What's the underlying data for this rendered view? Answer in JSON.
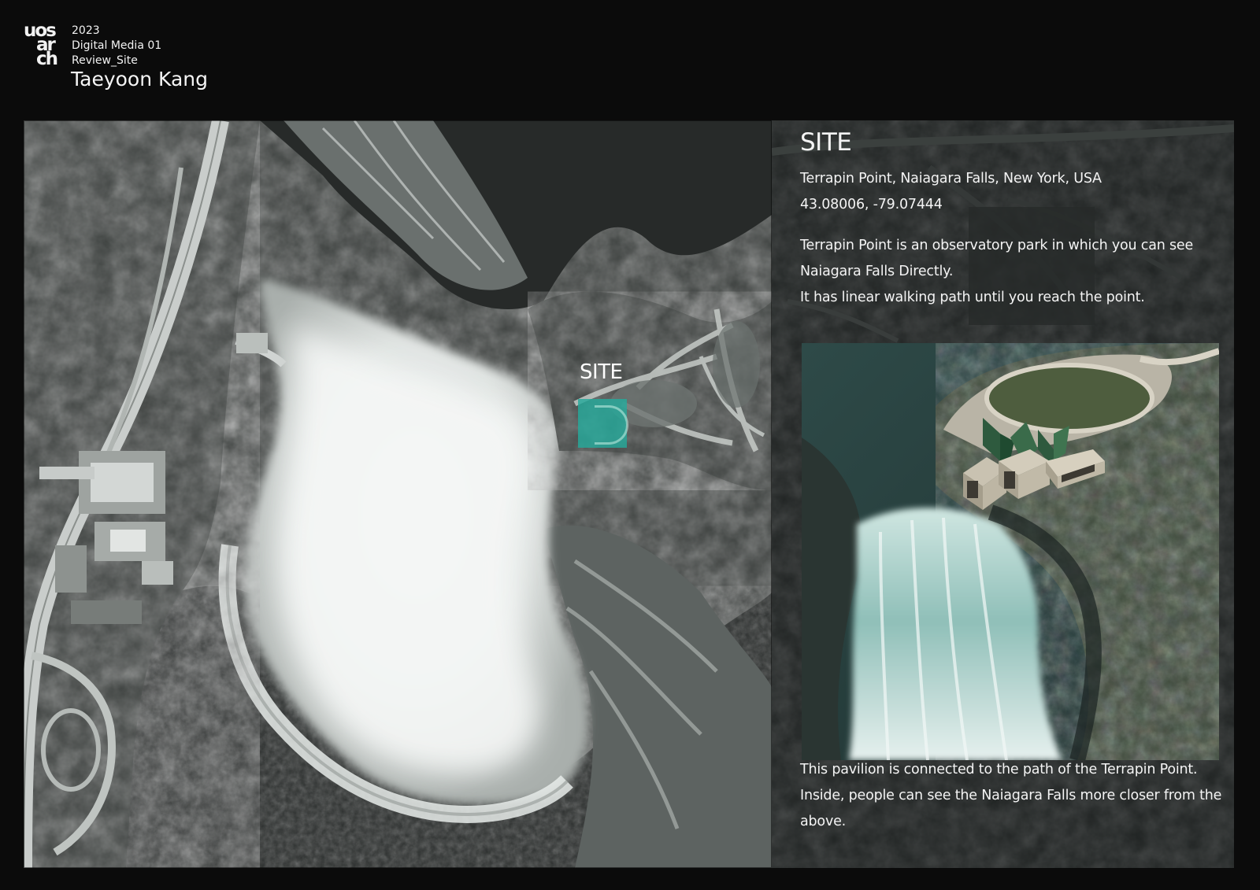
{
  "header": {
    "logo": {
      "line1": "uos",
      "line2": "ar",
      "line3": "ch"
    },
    "year": "2023",
    "course": "Digital Media 01",
    "review": "Review_Site",
    "author": "Taeyoon Kang"
  },
  "map": {
    "site_label": "SITE",
    "marker_color": "#26aa9b"
  },
  "info": {
    "title": "SITE",
    "location": "Terrapin Point, Naiagara Falls, New York, USA",
    "coordinates": "43.08006, -79.07444",
    "description": [
      "Terrapin Point is an observatory park in which you can see",
      "Naiagara Falls Directly.",
      "It has linear walking path until you reach the point."
    ],
    "footer": [
      "This pavilion is connected to the path of the Terrapin Point.",
      "Inside, people can see the Naiagara Falls more closer from the",
      "above."
    ]
  }
}
